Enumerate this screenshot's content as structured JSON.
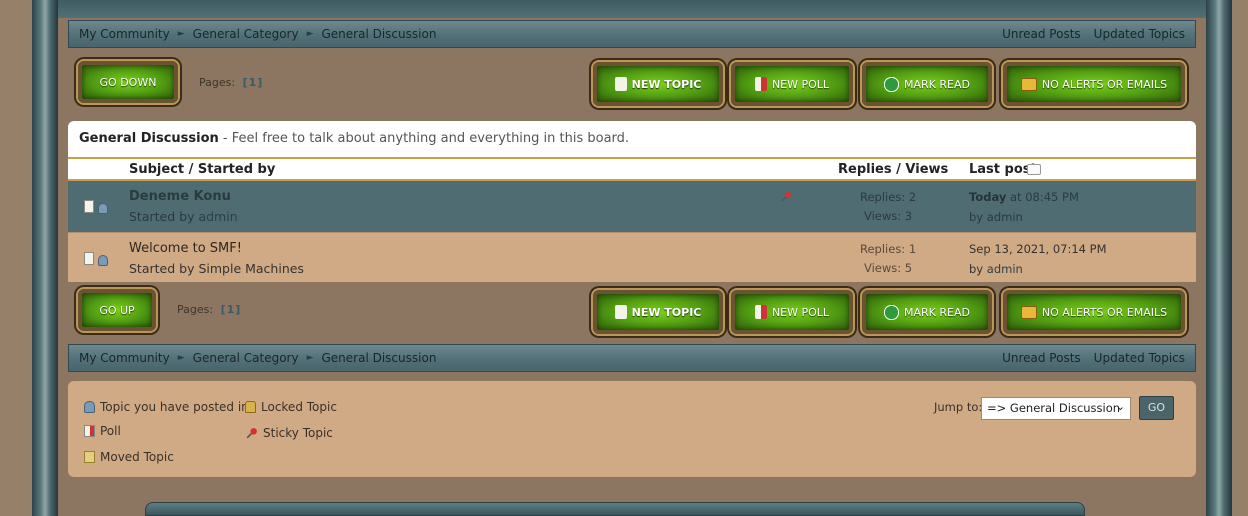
{
  "linktree": {
    "crumbs": [
      "My Community",
      "General Category",
      "General Discussion"
    ],
    "separator": "►",
    "right_links": [
      "Unread Posts",
      "Updated Topics"
    ]
  },
  "nav": {
    "go_down": "GO DOWN",
    "go_up": "GO UP",
    "pages_label": "Pages:",
    "pages_value": "[1]"
  },
  "buttons": {
    "new_topic": "NEW TOPIC",
    "new_poll": "NEW POLL",
    "mark_read": "MARK READ",
    "no_alerts": "NO ALERTS OR EMAILS"
  },
  "board": {
    "name": "General Discussion",
    "description": " - Feel free to talk about anything and everything in this board."
  },
  "columns": {
    "subject": "Subject / Started by",
    "replies_views": "Replies / Views",
    "last_post": "Last post"
  },
  "topics": [
    {
      "subject": "Deneme Konu",
      "started_prefix": "Started by ",
      "author": "admin",
      "replies": "Replies: 2",
      "views": "Views: 3",
      "last_date_bold": "Today",
      "last_date_rest": " at 08:45 PM",
      "last_by_prefix": "by ",
      "last_by": "admin",
      "sticky": true
    },
    {
      "subject": "Welcome to SMF!",
      "started_prefix": "Started by ",
      "author": "Simple Machines",
      "replies": "Replies: 1",
      "views": "Views: 5",
      "last_date_bold": "",
      "last_date_rest": "Sep 13, 2021, 07:14 PM",
      "last_by_prefix": "by ",
      "last_by": "admin",
      "sticky": false
    }
  ],
  "legend": {
    "posted_in": "Topic you have posted in",
    "poll": "Poll",
    "moved": "Moved Topic",
    "locked": "Locked Topic",
    "sticky": "Sticky Topic"
  },
  "jump": {
    "label": "Jump to:",
    "selected": "=> General Discussion",
    "go": "GO"
  },
  "colors": {
    "sticky_row": "#4f6c72",
    "normal_row": "#d0a985",
    "button_green": "#4f9a12",
    "accent_gold": "#c9a048"
  }
}
